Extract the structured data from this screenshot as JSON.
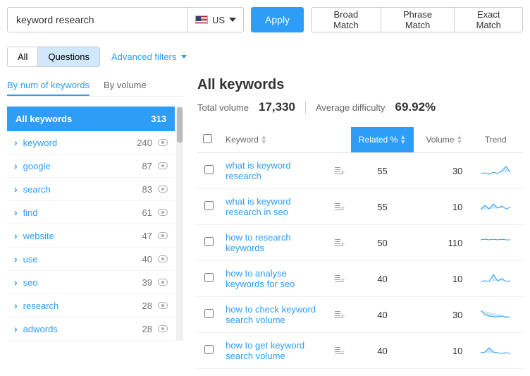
{
  "search": {
    "value": "keyword research",
    "country": "US"
  },
  "apply_label": "Apply",
  "match_modes": [
    "Broad Match",
    "Phrase Match",
    "Exact Match"
  ],
  "segments": {
    "all": "All",
    "questions": "Questions"
  },
  "advanced_filters": "Advanced filters",
  "sort_tabs": {
    "num": "By num of keywords",
    "volume": "By volume"
  },
  "sidebar": {
    "head_label": "All keywords",
    "head_count": "313",
    "items": [
      {
        "name": "keyword",
        "count": "240"
      },
      {
        "name": "google",
        "count": "87"
      },
      {
        "name": "search",
        "count": "83"
      },
      {
        "name": "find",
        "count": "61"
      },
      {
        "name": "website",
        "count": "47"
      },
      {
        "name": "use",
        "count": "40"
      },
      {
        "name": "seo",
        "count": "39"
      },
      {
        "name": "research",
        "count": "28"
      },
      {
        "name": "adwords",
        "count": "28"
      }
    ]
  },
  "results": {
    "title": "All keywords",
    "total_volume_label": "Total volume",
    "total_volume": "17,330",
    "avg_diff_label": "Average difficulty",
    "avg_diff": "69.92%",
    "columns": {
      "keyword": "Keyword",
      "related": "Related %",
      "volume": "Volume",
      "trend": "Trend"
    },
    "rows": [
      {
        "kw": "what is keyword research",
        "related": "55",
        "volume": "30",
        "spark": "0,14 6,13 12,15 18,12 24,14 30,10 36,4 42,12"
      },
      {
        "kw": "what is keyword research in seo",
        "related": "55",
        "volume": "10",
        "spark": "0,14 6,8 12,13 18,6 24,12 30,9 36,13 42,11"
      },
      {
        "kw": "how to research keywords",
        "related": "50",
        "volume": "110",
        "spark": "0,6 6,5 12,6 18,5 24,6 30,5 36,6 42,6"
      },
      {
        "kw": "how to analyse keywords for seo",
        "related": "40",
        "volume": "10",
        "spark": "0,14 6,13 12,14 18,4 24,13 30,10 36,14 42,13"
      },
      {
        "kw": "how to check keyword search volume",
        "related": "40",
        "volume": "30",
        "spark": "0,4 6,10 12,12 18,13 24,13 30,12 36,14 42,13"
      },
      {
        "kw": "how to get keyword search volume",
        "related": "40",
        "volume": "10",
        "spark": "0,13 6,12 12,6 18,12 24,13 30,14 36,13 42,14"
      }
    ]
  }
}
